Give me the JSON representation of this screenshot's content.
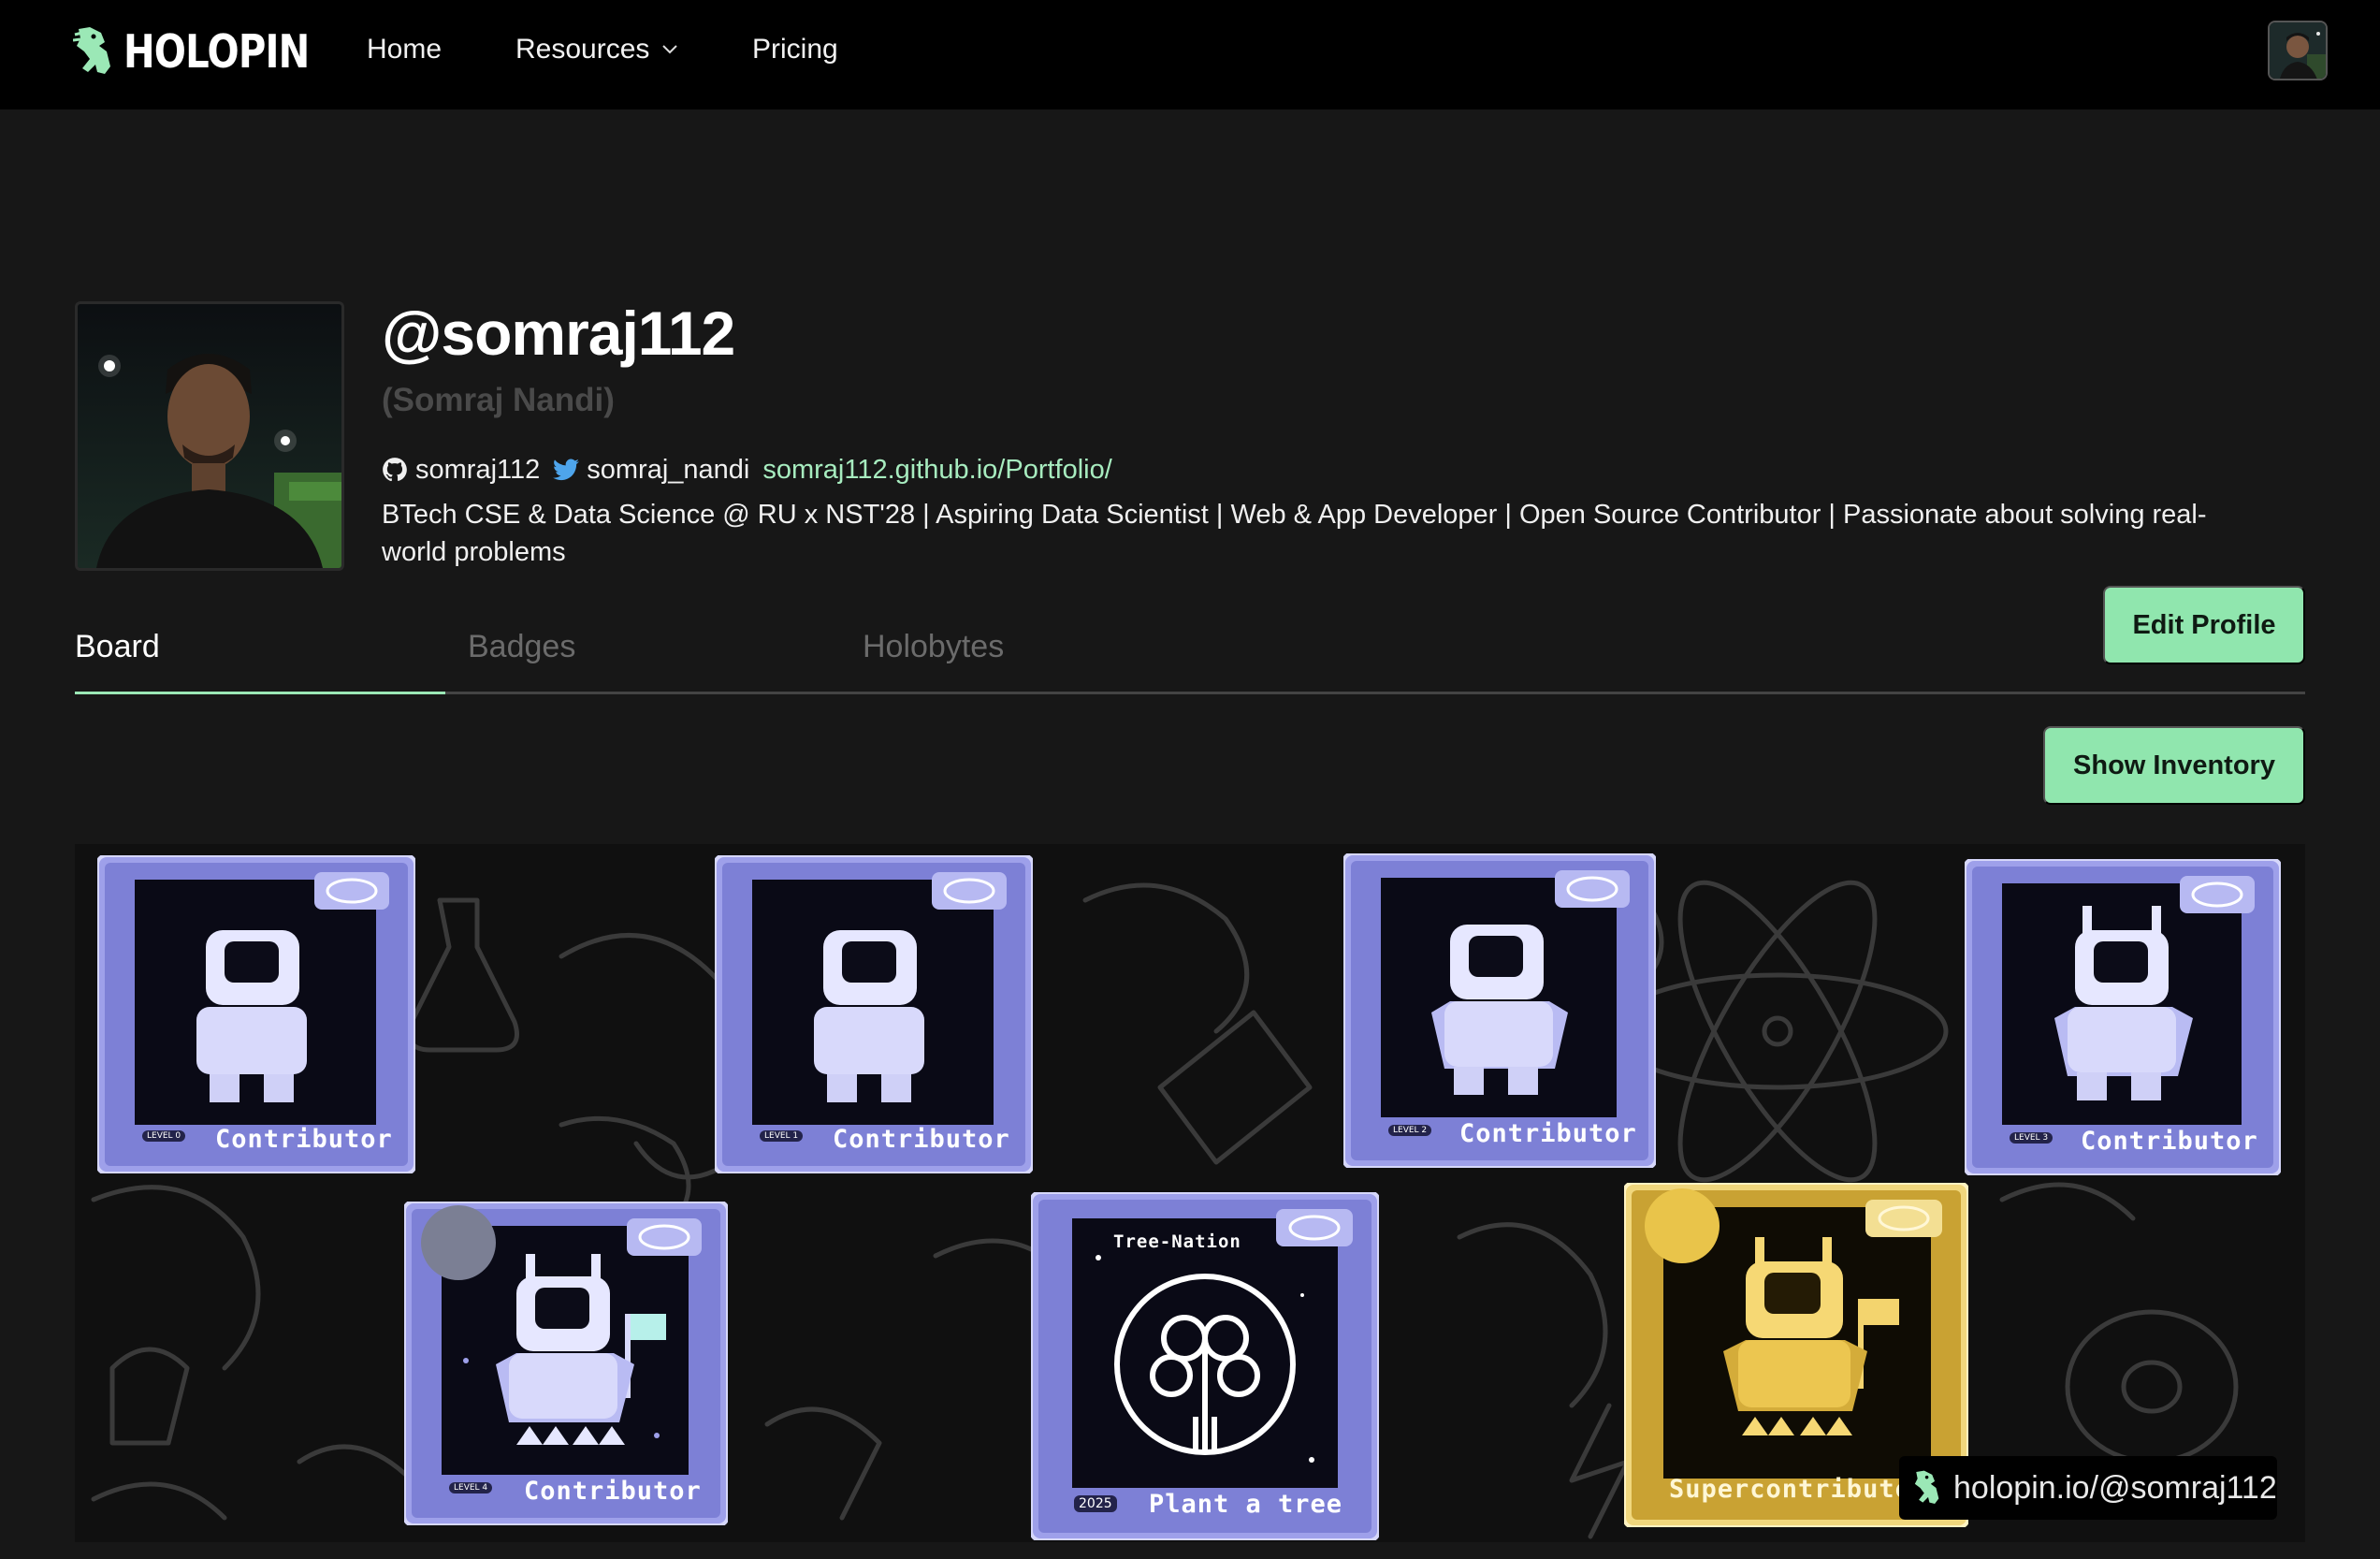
{
  "nav": {
    "logo_text": "HOLOPIN",
    "links": {
      "home": "Home",
      "resources": "Resources",
      "pricing": "Pricing"
    }
  },
  "profile": {
    "handle": "@somraj112",
    "full_name": "(Somraj Nandi)",
    "github": "somraj112",
    "twitter": "somraj_nandi",
    "website": "somraj112.github.io/Portfolio/",
    "bio": "BTech CSE & Data Science @ RU x NST'28 | Aspiring Data Scientist | Web & App Developer | Open Source Contributor | Passionate about solving real-world problems"
  },
  "tabs": {
    "board": "Board",
    "badges": "Badges",
    "holobytes": "Holobytes"
  },
  "buttons": {
    "edit_profile": "Edit Profile",
    "show_inventory": "Show Inventory"
  },
  "pins": [
    {
      "label": "Contributor",
      "level": "LEVEL 0"
    },
    {
      "label": "Contributor",
      "level": "LEVEL 1"
    },
    {
      "label": "Contributor",
      "level": "LEVEL 2"
    },
    {
      "label": "Contributor",
      "level": "LEVEL 3"
    },
    {
      "label": "Contributor",
      "level": "LEVEL 4"
    },
    {
      "label": "Plant a tree",
      "top_label": "Tree-Nation",
      "year": "2025"
    },
    {
      "label": "Supercontributor"
    }
  ],
  "watermark": "holopin.io/@somraj112",
  "colors": {
    "accent_green": "#90e6ae",
    "link_green": "#a7ecbf",
    "pin_purple": "#8d8fe0",
    "pin_gold": "#e7c14a"
  }
}
